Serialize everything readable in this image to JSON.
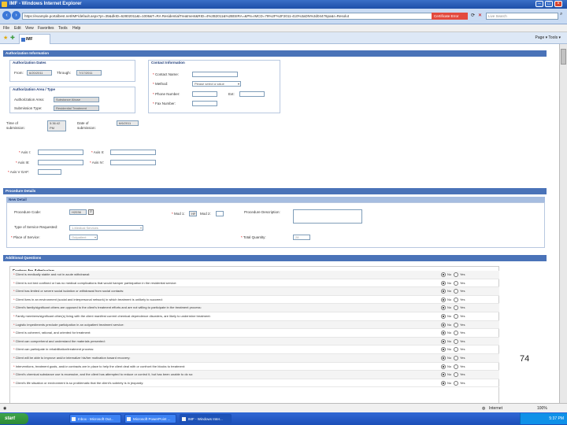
{
  "window": {
    "title": "IMF - Windows Internet Explorer"
  },
  "address": {
    "url": "https://example.portalbest.net/IMF/default.aspx?pr=35&dkID=62802011&t=1006&T=RA ResidentialTreatment&RID=4%2B2011&%2BtSIRA=&PN=IMCD=79%2F%2F2011-410%3aDN%3d04476pa&r=Resolut",
    "cert_error": "Certificate Error",
    "search_placeholder": "Live Search"
  },
  "menu": [
    "File",
    "Edit",
    "View",
    "Favorites",
    "Tools",
    "Help"
  ],
  "tab": {
    "label": "IMF"
  },
  "tools_text": "Page ▾  Tools ▾",
  "auth": {
    "section_title": "Authorization Information",
    "dates_title": "Authorization Dates",
    "from_label": "From:",
    "from_value": "6/20/2011",
    "through_label": "Through:",
    "through_value": "7/17/2011",
    "area_title": "Authorization Area / Type",
    "area_label": "Authorization Area:",
    "area_value": "Substance Abuse",
    "type_label": "Submission Type:",
    "type_value": "Residential Treatment",
    "time_label": "Time of submission:",
    "time_value": "5:36:42 PM",
    "date_label": "Date of submission:",
    "date_value": "6/6/2011",
    "contact_title": "Contact Information",
    "contact_name_label": "Contact Name:",
    "method_label": "Method:",
    "method_value": "Please select a value",
    "phone_label": "Phone Number:",
    "ext_label": "Ext:",
    "fax_label": "Fax Number:",
    "axis1_label": "Axis I:",
    "axis2_label": "Axis II:",
    "axis3_label": "Axis III:",
    "axis4_label": "Axis IV:",
    "axis5_label": "Axis V GAF:"
  },
  "procedure": {
    "section_title": "Procedure Details",
    "sub_title": "New Detail",
    "code_label": "Procedure Code:",
    "code_value": "H2036",
    "mod1_label": "Mod 1:",
    "mod1_value": "HF",
    "mod2_label": "Mod 2:",
    "desc_label": "Procedure Description:",
    "service_label": "Type of Service Requested:",
    "service_value": "1-Medical Services",
    "place_label": "Place of Service:",
    "place_value": "Outpatient",
    "qty_label": "Total Quantity:",
    "qty_value": "28"
  },
  "additional": {
    "section_title": "Additional Questions",
    "factors_title": "Factors for Admission",
    "no_label": "No",
    "yes_label": "Yes",
    "questions": [
      "Client is medically stable and not in acute withdrawal:",
      "Client is not bed confined or has no medical complications that would hamper participation in the residential service:",
      "Client has limited or severe social isolation or withdrawal from social contacts:",
      "Client lives in an environment (social and interpersonal network) in which treatment is unlikely to succeed:",
      "Client's family/significant others are opposed to the client's treatment efforts and are not willing to participate in the treatment process:",
      "Family members/significant other(s) living with the client manifest current chemical dependence disorders, are likely to undermine treatment:",
      "Logistic impediments preclude participation in an outpatient treatment service:",
      "Client is coherent, rational, and oriented for treatment:",
      "Client can comprehend and understand the materials presented:",
      "Client can participate in rehabilitation/treatment process:",
      "Client will be able to improve and/or internalize his/her motivation toward recovery:",
      "Interventions, treatment goals, and/or contracts are in place to help the client deal with or confront the blocks to treatment:",
      "Client's chemical substance use is excessive, and the client has attempted to reduce or control it, but has been unable to do so:",
      "Client's life situation or environment is so problematic that the client's sobriety is in jeopardy:"
    ]
  },
  "slide_number": "74",
  "status": {
    "zone": "Internet",
    "zoom": "100%"
  },
  "taskbar": {
    "start": "start",
    "tasks": [
      "Inbox - Microsoft Out...",
      "Microsoft PowerPoint ...",
      "IMF - Windows Inter..."
    ],
    "clock": "5:37 PM"
  },
  "colors": {
    "section_bar": "#4a73b8",
    "subsection_bar": "#a6bde0",
    "required_star": "#dd0000",
    "cert_error": "#e34a3e"
  }
}
